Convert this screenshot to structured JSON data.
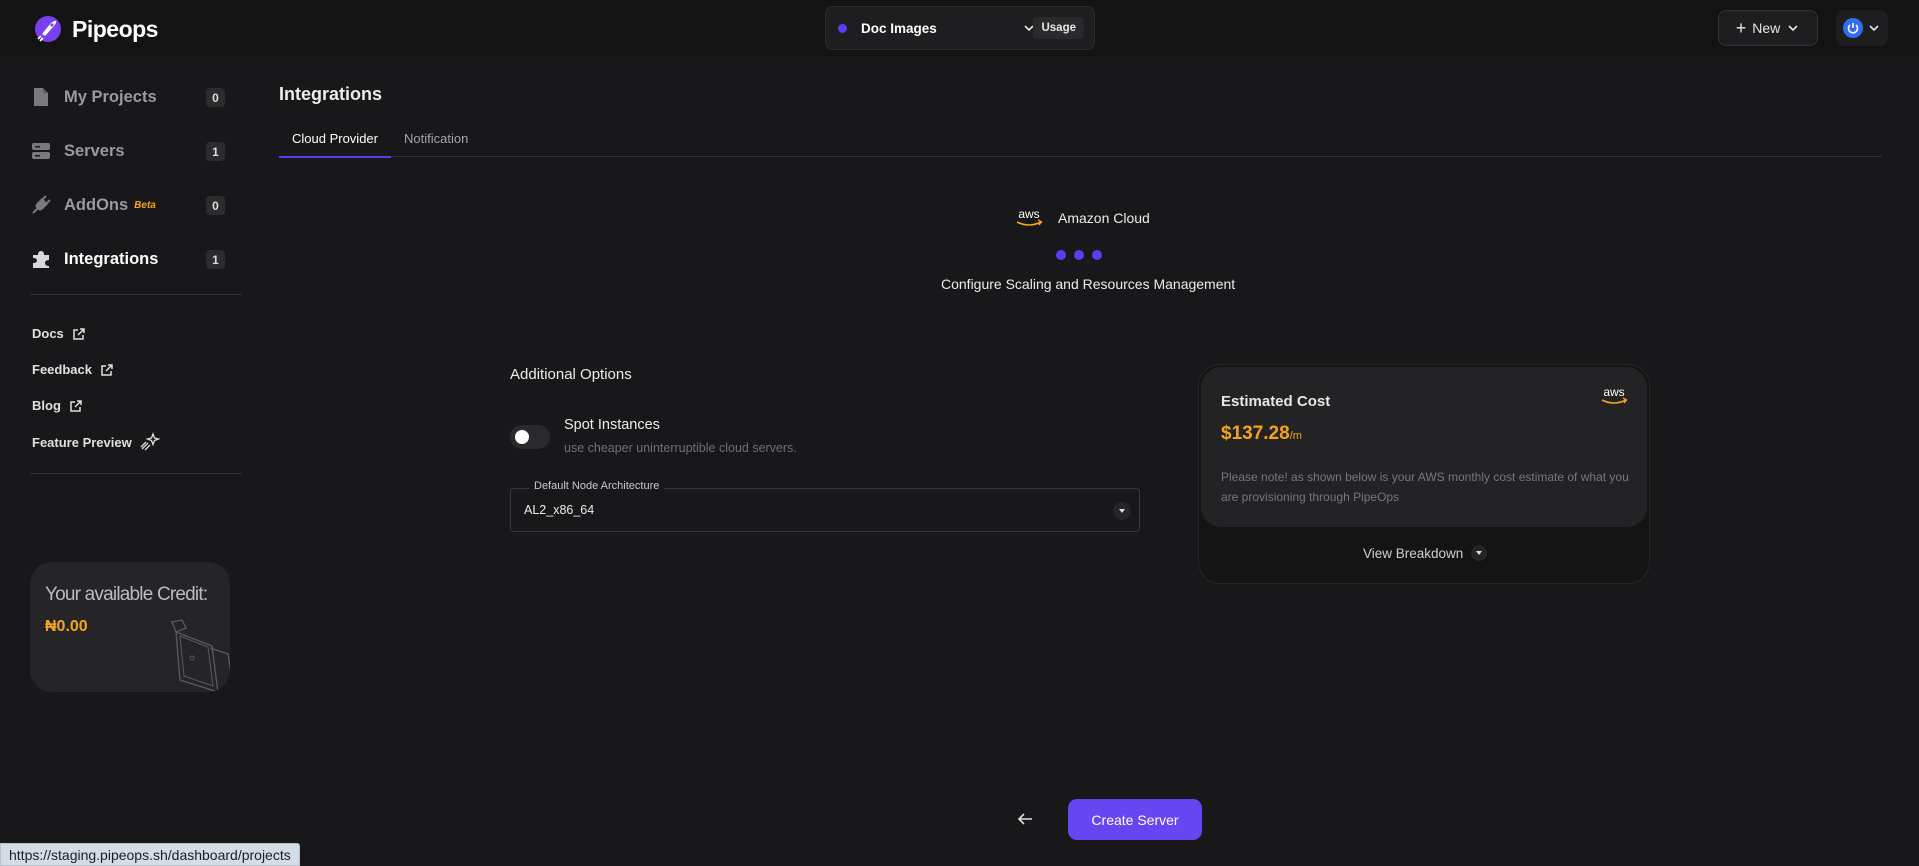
{
  "app": {
    "name": "Pipeops"
  },
  "topbar": {
    "project_name": "Doc Images",
    "usage_label": "Usage",
    "new_label": "New"
  },
  "sidebar": {
    "items": [
      {
        "label": "My Projects",
        "count": "0",
        "icon": "file-icon"
      },
      {
        "label": "Servers",
        "count": "1",
        "icon": "server-icon"
      },
      {
        "label": "AddOns",
        "badge": "Beta",
        "count": "0",
        "icon": "plug-icon"
      },
      {
        "label": "Integrations",
        "count": "1",
        "icon": "puzzle-icon",
        "active": true
      }
    ],
    "links": [
      {
        "label": "Docs",
        "icon": "external-link-icon"
      },
      {
        "label": "Feedback",
        "icon": "external-link-icon"
      },
      {
        "label": "Blog",
        "icon": "external-link-icon"
      },
      {
        "label": "Feature Preview",
        "icon": "sparkle-icon"
      }
    ],
    "credit": {
      "title": "Your available Credit:",
      "amount": "₦0.00"
    }
  },
  "main": {
    "title": "Integrations",
    "tabs": [
      {
        "label": "Cloud Provider",
        "active": true
      },
      {
        "label": "Notification"
      }
    ],
    "provider_name": "Amazon Cloud",
    "step_title": "Configure Scaling and Resources Management",
    "options_title": "Additional Options",
    "spot": {
      "label": "Spot Instances",
      "description": "use cheaper uninterruptible cloud servers.",
      "enabled": false
    },
    "architecture": {
      "label": "Default Node Architecture",
      "value": "AL2_x86_64"
    },
    "cost": {
      "title": "Estimated Cost",
      "amount": "$137.28",
      "unit": "/m",
      "note": "Please note! as shown below is your AWS monthly cost estimate of what you are provisioning through PipeOps",
      "breakdown_label": "View Breakdown"
    },
    "create_label": "Create Server"
  },
  "status_bar": {
    "url": "https://staging.pipeops.sh/dashboard/projects"
  },
  "colors": {
    "accent": "#5b3df5",
    "button": "#6546f0",
    "highlight": "#f2a51a",
    "background": "#18181a"
  }
}
